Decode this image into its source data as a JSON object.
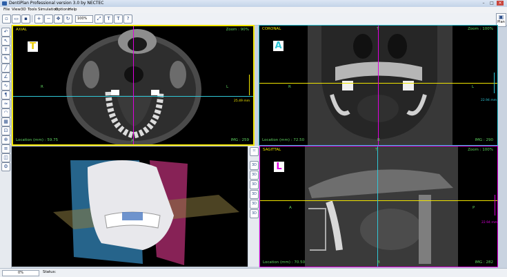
{
  "window": {
    "title": "DentiPlan Professional version 3.0 by NECTEC",
    "minimize": "–",
    "maximize": "□",
    "close": "×"
  },
  "menu": [
    "File",
    "View",
    "3D",
    "Tools",
    "Simulation",
    "Options",
    "Help"
  ],
  "toolbar": {
    "zoom_value": "100%",
    "plan_label": "Plan"
  },
  "views": {
    "axial": {
      "title": "AXIAL",
      "zoom": "Zoom : 90%",
      "letter": "T",
      "left_label": "R",
      "right_label": "L",
      "bottom_label": "A",
      "location": "Location (mm) : 59.75",
      "img": "IMG : 259",
      "measure": "25.49 mm",
      "frame_color": "#f2e600"
    },
    "coronal": {
      "title": "CORONAL",
      "zoom": "Zoom : 100%",
      "letter": "A",
      "top_label": "T",
      "left_label": "R",
      "right_label": "L",
      "bottom_label": "B",
      "location": "Location (mm) : 72.50",
      "img": "IMG : 290",
      "measure": "22.94 mm",
      "frame_color": "#30c8d8"
    },
    "sagittal": {
      "title": "SAGITTAL",
      "zoom": "Zoom : 100%",
      "letter": "L",
      "top_label": "T",
      "left_label": "A",
      "right_label": "P",
      "bottom_label": "B",
      "location": "Location (mm) : 70.50",
      "img": "IMG : 282",
      "measure": "22.94 mm",
      "frame_color": "#e000e0"
    }
  },
  "status": {
    "progress": "0%",
    "text": "Status:"
  }
}
